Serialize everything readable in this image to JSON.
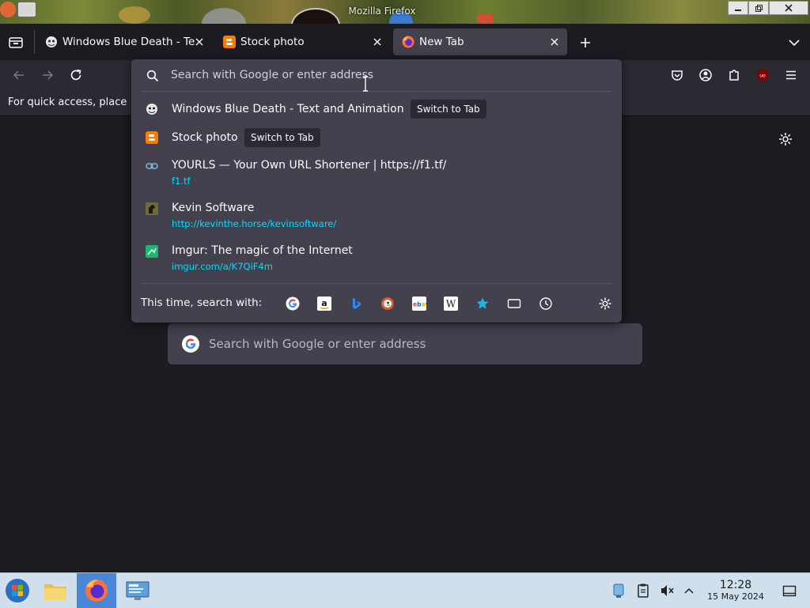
{
  "window": {
    "title": "Mozilla Firefox"
  },
  "tabs": [
    {
      "label": "Windows Blue Death - Te",
      "active": false
    },
    {
      "label": "Stock photo",
      "active": false
    },
    {
      "label": "New Tab",
      "active": true
    }
  ],
  "bookmarks_bar": {
    "hint": "For quick access, place"
  },
  "urlbar": {
    "placeholder": "Search with Google or enter address",
    "results": [
      {
        "title": "Windows Blue Death - Text and Animation",
        "badge": "Switch to Tab",
        "icon": "skull-face-icon"
      },
      {
        "title": "Stock photo",
        "badge": "Switch to Tab",
        "icon": "blogger-icon"
      },
      {
        "title": "YOURLS — Your Own URL Shortener | https://f1.tf/",
        "url": "f1.tf",
        "icon": "chain-link-icon"
      },
      {
        "title": "Kevin Software",
        "url": "http://kevinthe.horse/kevinsoftware/",
        "icon": "horse-icon"
      },
      {
        "title": "Imgur: The magic of the Internet",
        "url": "imgur.com/a/K7QiF4m",
        "icon": "imgur-icon"
      }
    ],
    "search_with_label": "This time, search with:",
    "engines": [
      "google-icon",
      "amazon-icon",
      "bing-icon",
      "duckduckgo-icon",
      "ebay-icon",
      "wikipedia-icon",
      "bookmarks-star-icon",
      "tabs-icon",
      "history-icon"
    ]
  },
  "content": {
    "search_placeholder": "Search with Google or enter address"
  },
  "taskbar": {
    "time": "12:28",
    "date": "15 May 2024"
  },
  "colors": {
    "accent_url": "#00ddff",
    "toolbar": "#2b2a33",
    "panel": "#42414d",
    "page_bg": "#1c1b22"
  }
}
